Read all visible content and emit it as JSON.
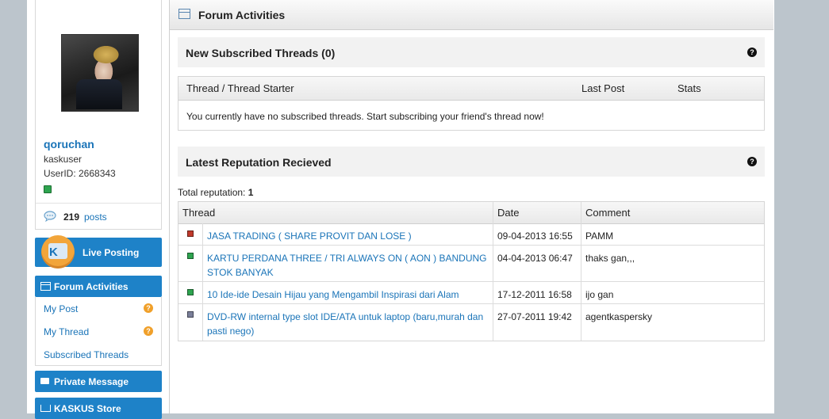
{
  "sidebar": {
    "username": "qoruchan",
    "usergroup": "kaskuser",
    "userid": "UserID: 2668343",
    "posts_count": "219",
    "posts_label": "posts",
    "live_posting": "Live Posting",
    "forum_activities": "Forum Activities",
    "submenu": [
      {
        "label": "My Post",
        "has_help": true
      },
      {
        "label": "My Thread",
        "has_help": true
      },
      {
        "label": "Subscribed Threads",
        "has_help": false
      }
    ],
    "private_message": "Private Message",
    "kaskus_store": "KASKUS Store",
    "help_glyph": "?"
  },
  "main": {
    "title": "Forum Activities",
    "subscribed": {
      "title": "New Subscribed Threads (0)",
      "columns": [
        "Thread / Thread Starter",
        "Last Post",
        "Stats"
      ],
      "empty_message": "You currently have no subscribed threads. Start subscribing your friend's thread now!"
    },
    "reputation": {
      "title": "Latest Reputation Recieved",
      "total_label": "Total reputation:",
      "total_value": "1",
      "columns": [
        "Thread",
        "Date",
        "Comment"
      ],
      "rows": [
        {
          "color": "#c0392b",
          "thread": "JASA TRADING ( SHARE PROVIT DAN LOSE )",
          "date": "09-04-2013 16:55",
          "comment": "PAMM"
        },
        {
          "color": "#2ea44f",
          "thread": "KARTU PERDANA THREE / TRI ALWAYS ON ( AON ) BANDUNG STOK BANYAK",
          "date": "04-04-2013 06:47",
          "comment": "thaks gan,,,"
        },
        {
          "color": "#2ea44f",
          "thread": "10 Ide-ide Desain Hijau yang Mengambil Inspirasi dari Alam",
          "date": "17-12-2011 16:58",
          "comment": "ijo gan"
        },
        {
          "color": "#7a7f99",
          "thread": "DVD-RW internal type slot IDE/ATA untuk laptop (baru,murah dan pasti nego)",
          "date": "27-07-2011 19:42",
          "comment": "agentkaspersky"
        }
      ]
    }
  }
}
